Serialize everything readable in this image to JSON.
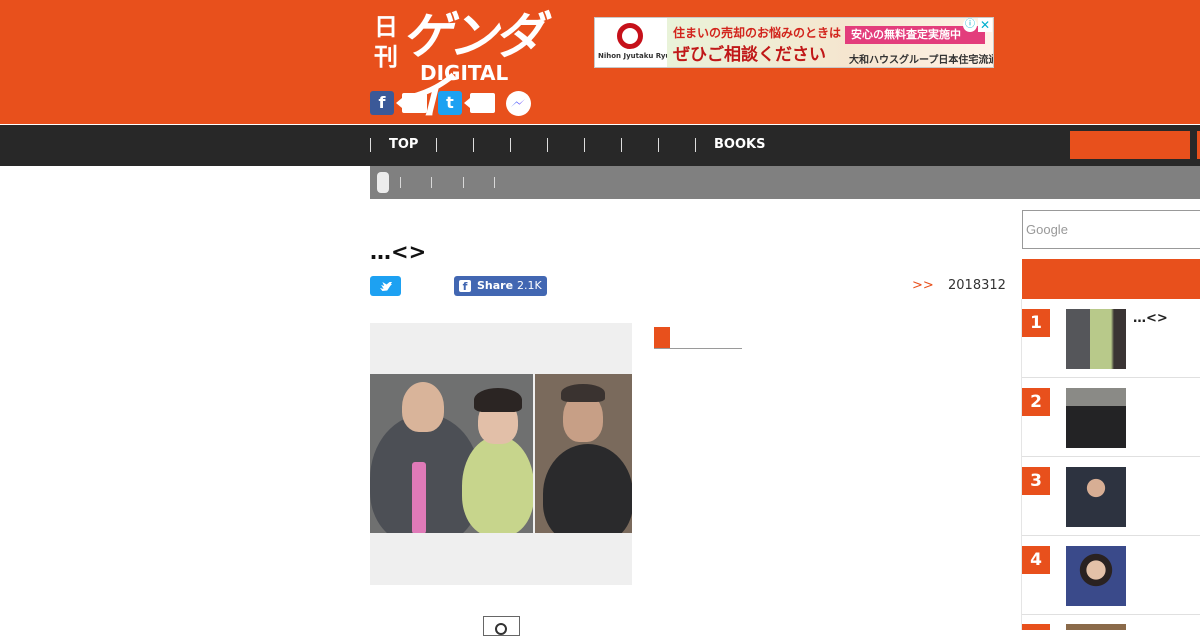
{
  "site": {
    "logo_kan": "日刊",
    "logo_main": "ゲンダイ",
    "logo_sub": "DIGITAL"
  },
  "ad": {
    "advertiser": "Nihon Jyutaku Ryutu.",
    "line1": "住まいの売却のお悩みのときは",
    "line2": "ぜひご相談ください",
    "badge": "安心の無料査定実施中",
    "footer": "大和ハウスグループ日本住宅流通へ",
    "info_icon": "info-icon",
    "close_icon": "close-icon"
  },
  "nav": {
    "items": [
      "TOP",
      "",
      "",
      "",
      "",
      "",
      "",
      "",
      "BOOKS"
    ]
  },
  "article": {
    "title": "…<>",
    "share_label": "Share",
    "share_count": "2.1K",
    "breadcrumb": ">>",
    "date": "2018312"
  },
  "sidebar": {
    "search_placeholder": "Google",
    "ranking": [
      {
        "rank": "1",
        "title": "…<>"
      },
      {
        "rank": "2",
        "title": ""
      },
      {
        "rank": "3",
        "title": ""
      },
      {
        "rank": "4",
        "title": ""
      }
    ]
  },
  "colors": {
    "brand": "#e8501c",
    "nav_bg": "#282828",
    "subbar_bg": "#808080"
  }
}
